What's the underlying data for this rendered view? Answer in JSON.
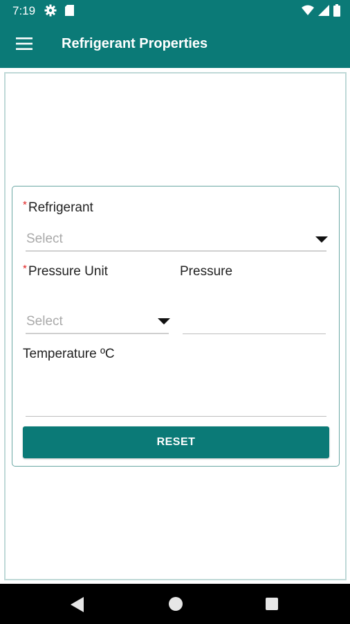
{
  "status_bar": {
    "time": "7:19",
    "icons": [
      "gear-icon",
      "sd-card-icon",
      "wifi-icon",
      "signal-icon",
      "battery-icon"
    ]
  },
  "app_bar": {
    "title": "Refrigerant Properties",
    "menu_icon": "menu-icon",
    "background": "#0b7a77"
  },
  "form": {
    "refrigerant": {
      "required_mark": "*",
      "label": "Refrigerant",
      "placeholder": "Select"
    },
    "pressure_unit": {
      "required_mark": "*",
      "label": "Pressure Unit",
      "placeholder": "Select"
    },
    "pressure": {
      "label": "Pressure",
      "value": ""
    },
    "temperature": {
      "label": "Temperature ºC",
      "value": ""
    },
    "reset_label": "RESET"
  },
  "nav_bar": {
    "icons": [
      "back-icon",
      "home-icon",
      "recents-icon"
    ]
  },
  "colors": {
    "accent": "#0b7a77",
    "required": "#e02020",
    "placeholder": "#a9a9a9"
  }
}
